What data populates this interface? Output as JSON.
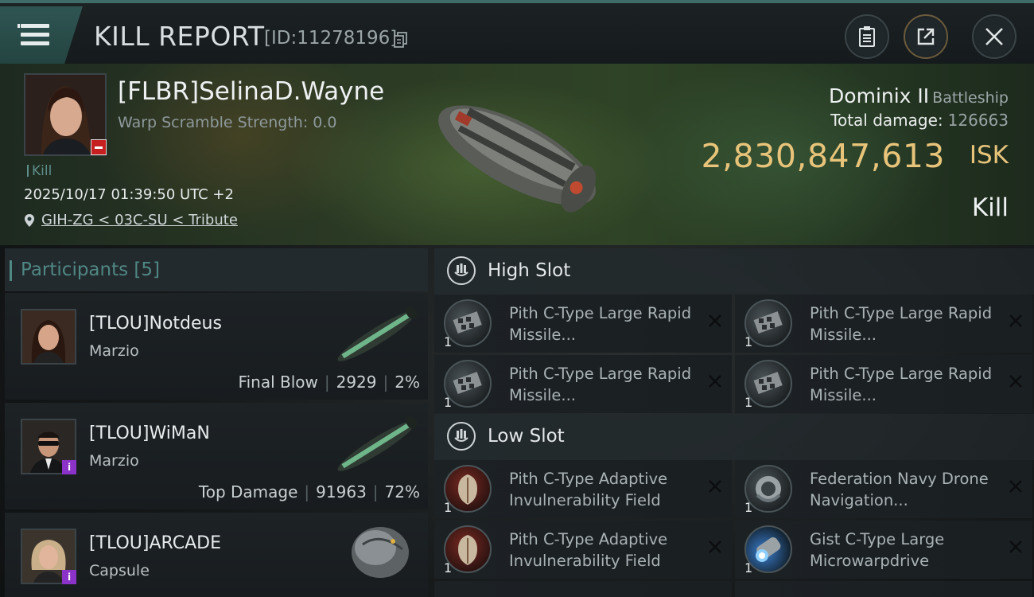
{
  "header": {
    "title": "KILL REPORT",
    "report_id": "[ID:11278196]"
  },
  "victim": {
    "name": "[FLBR]SelinaD.Wayne",
    "warp_scramble": "Warp Scramble Strength: 0.0",
    "tag": "Kill",
    "timestamp": "2025/10/17 01:39:50 UTC +2",
    "location": "GIH-ZG < 03C-SU < Tribute",
    "ship_name": "Dominix II",
    "ship_class": "Battleship",
    "total_damage_label": "Total damage:",
    "total_damage_value": "126663",
    "isk_value": "2,830,847,613",
    "isk_unit": "ISK",
    "result": "Kill"
  },
  "participants": {
    "label": "Participants [5]",
    "items": [
      {
        "name": "[TLOU]Notdeus",
        "ship": "Marzio",
        "role": "Final Blow",
        "damage": "2929",
        "percent": "2%"
      },
      {
        "name": "[TLOU]WiMaN",
        "ship": "Marzio",
        "role": "Top Damage",
        "damage": "91963",
        "percent": "72%"
      },
      {
        "name": "[TLOU]ARCADE",
        "ship": "Capsule"
      }
    ]
  },
  "fitting": {
    "high_slot": {
      "title": "High Slot",
      "modules": [
        {
          "name": "Pith C-Type Large Rapid Missile...",
          "qty": "1"
        },
        {
          "name": "Pith C-Type Large Rapid Missile...",
          "qty": "1"
        },
        {
          "name": "Pith C-Type Large Rapid Missile...",
          "qty": "1"
        },
        {
          "name": "Pith C-Type Large Rapid Missile...",
          "qty": "1"
        }
      ]
    },
    "low_slot": {
      "title": "Low Slot",
      "modules": [
        {
          "name": "Pith C-Type Adaptive Invulnerability Field",
          "qty": "1"
        },
        {
          "name": "Federation Navy Drone Navigation...",
          "qty": "1"
        },
        {
          "name": "Pith C-Type Adaptive Invulnerability Field",
          "qty": "1"
        },
        {
          "name": "Gist C-Type Large Microwarpdrive",
          "qty": "1"
        }
      ]
    }
  },
  "colors": {
    "accent_teal": "#4f8783",
    "isk_gold": "#e8c47a",
    "badge_red": "#c51f1f",
    "badge_purple": "#8b33c9"
  }
}
